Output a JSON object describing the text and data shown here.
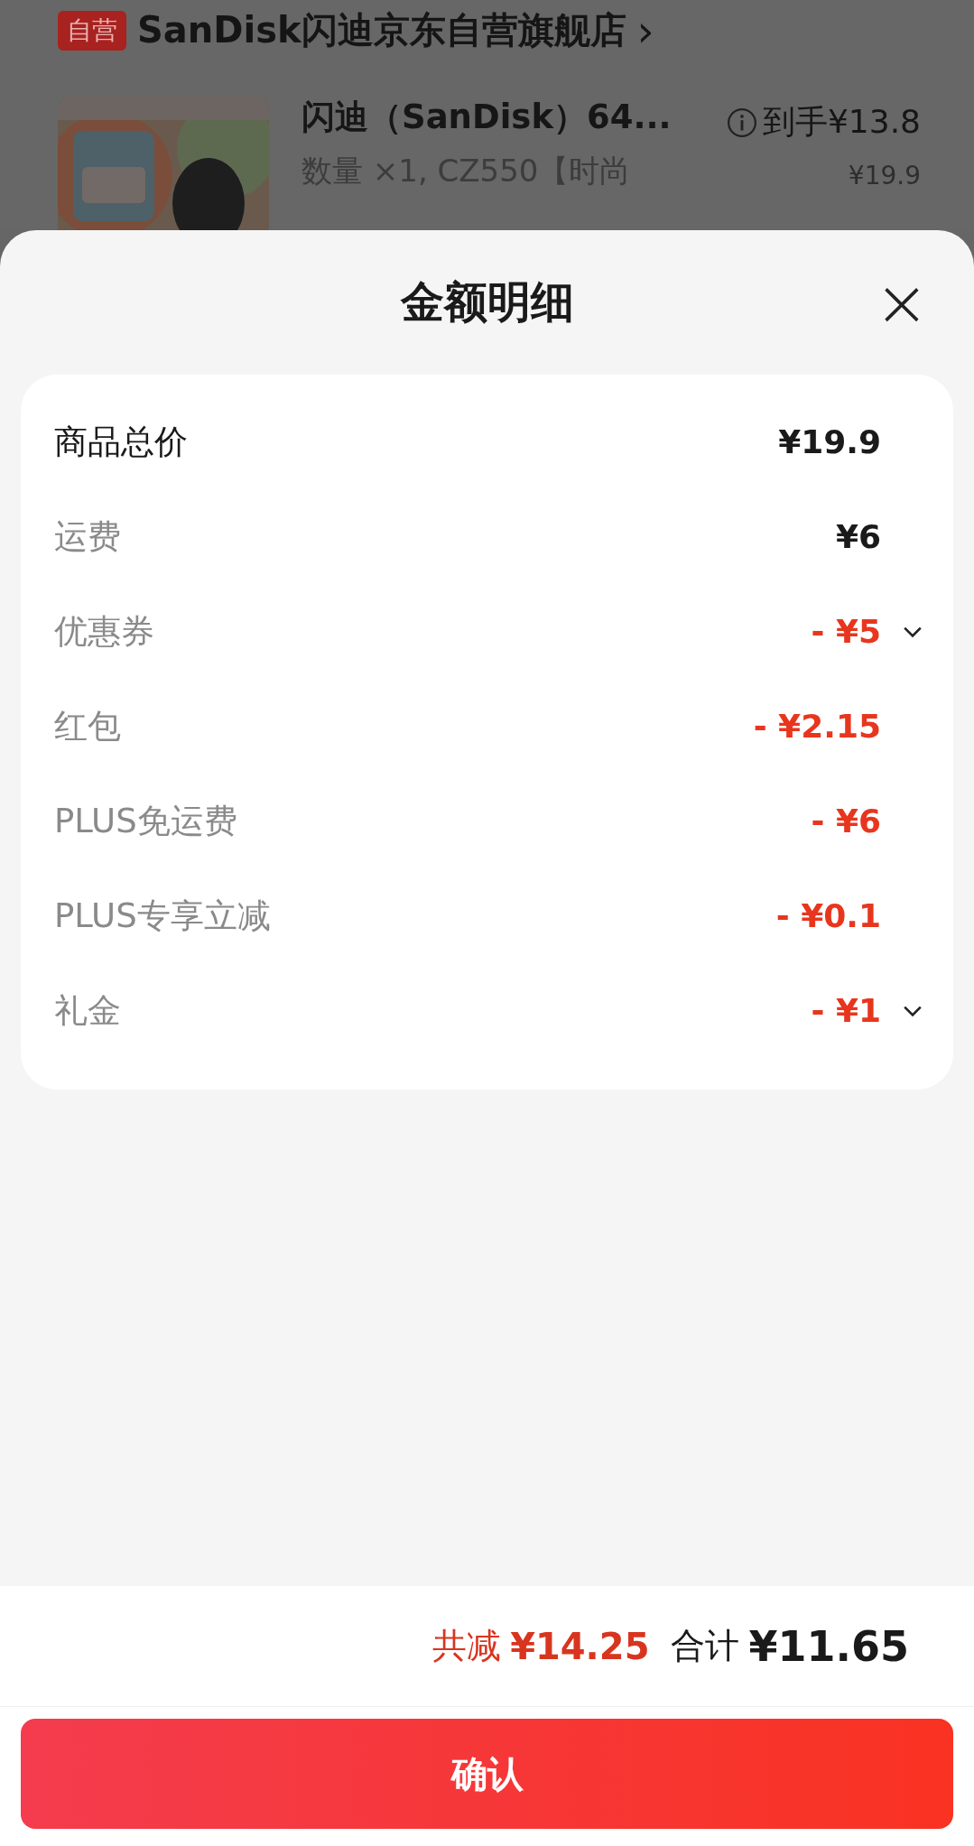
{
  "store": {
    "badge": "自营",
    "name": "SanDisk闪迪京东自营旗舰店",
    "arrow": "›"
  },
  "product": {
    "title": "闪迪（SanDisk）64...",
    "spec": "数量 ×1, CZ550【时尚",
    "final_price": "到手¥13.8",
    "original_price": "¥19.9"
  },
  "sheet": {
    "title": "金额明细",
    "close": "×"
  },
  "rows": [
    {
      "kind": "base",
      "label": "商品总价",
      "value": "¥19.9",
      "expandable": false
    },
    {
      "kind": "fee",
      "label": "运费",
      "value": "¥6",
      "expandable": false
    },
    {
      "kind": "discount",
      "label": "优惠券",
      "value": "- ¥5",
      "expandable": true
    },
    {
      "kind": "discount",
      "label": "红包",
      "value": "- ¥2.15",
      "expandable": false
    },
    {
      "kind": "discount",
      "label": "PLUS免运费",
      "value": "- ¥6",
      "expandable": false
    },
    {
      "kind": "discount",
      "label": "PLUS专享立减",
      "value": "- ¥0.1",
      "expandable": false
    },
    {
      "kind": "discount",
      "label": "礼金",
      "value": "- ¥1",
      "expandable": true
    }
  ],
  "summary": {
    "saved_label": "共减",
    "saved_value": "¥14.25",
    "total_label": "合计",
    "total_value": "¥11.65"
  },
  "confirm_button": "确认"
}
